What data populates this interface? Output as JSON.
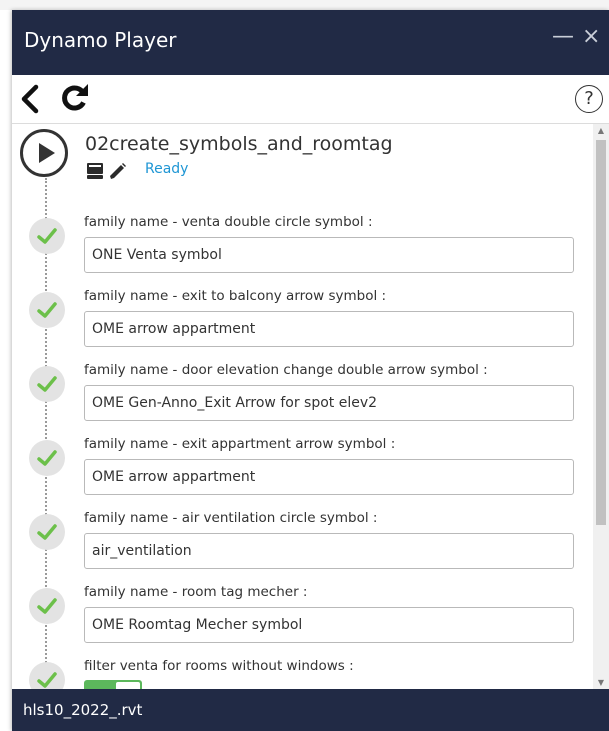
{
  "window": {
    "title": "Dynamo Player",
    "minimize_glyph": "—",
    "close_glyph": "×"
  },
  "toolbar": {
    "back_icon": "back-chevron-icon",
    "refresh_icon": "refresh-icon",
    "help_label": "?"
  },
  "script": {
    "name": "02create_symbols_and_roomtag",
    "status": "Ready",
    "status_color": "#1f96d4"
  },
  "inputs": [
    {
      "label": "family name - venta double circle symbol :",
      "value": "ONE Venta symbol"
    },
    {
      "label": "family name - exit to balcony arrow symbol :",
      "value": "OME arrow appartment"
    },
    {
      "label": "family name - door elevation change double arrow symbol :",
      "value": "OME Gen-Anno_Exit Arrow for spot elev2"
    },
    {
      "label": "family name - exit appartment arrow symbol :",
      "value": "OME arrow appartment"
    },
    {
      "label": "family name - air ventilation circle symbol :",
      "value": "air_ventilation"
    },
    {
      "label": "family name - room tag mecher :",
      "value": "OME Roomtag Mecher symbol"
    }
  ],
  "toggle_input": {
    "label": "filter venta for rooms without windows :",
    "state": "on"
  },
  "footer": {
    "file_name": "hls10_2022_.rvt"
  },
  "colors": {
    "titlebar_bg": "#212a45",
    "check_green": "#6cc04a",
    "toggle_green": "#5cb85c"
  }
}
